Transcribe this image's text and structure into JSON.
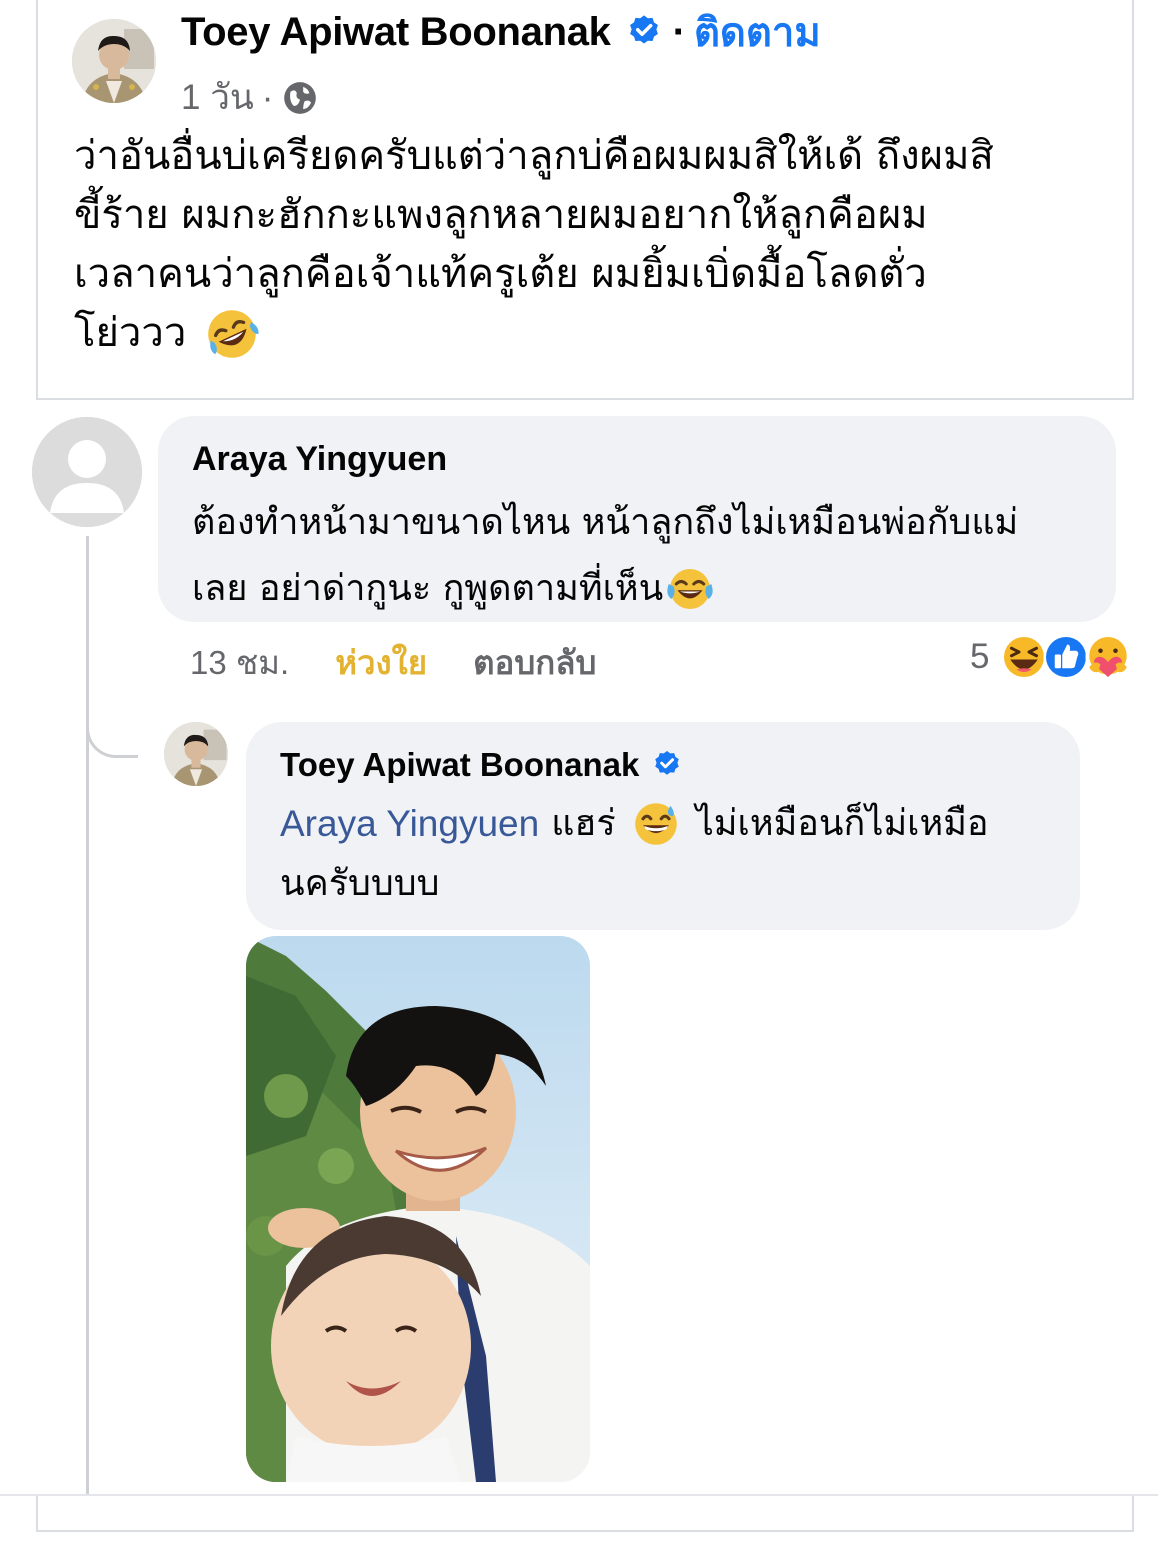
{
  "post": {
    "author": "Toey Apiwat Boonanak",
    "separator": "·",
    "follow_label": "ติดตาม",
    "time": "1 วัน",
    "meta_separator": "·",
    "privacy_icon": "globe-icon",
    "text_lines": [
      "ว่าอันอื่นบ่เครียดครับแต่ว่าลูกบ่คือผมผมสิให้เด้ ถึงผมสิ",
      "ขี้ร้าย ผมกะฮักกะแพงลูกหลายผมอยากให้ลูกคือผม",
      "เวลาคนว่าลูกคือเจ้าแท้ครูเต้ย ผมยิ้มเบิ่ดมื้อโลดตั่ว",
      "โย่ววว"
    ],
    "trailing_emoji": "rolling-on-floor-laughing-emoji"
  },
  "comment": {
    "author": "Araya Yingyuen",
    "text_lines": [
      "ต้องทำหน้ามาขนาดไหน หน้าลูกถึงไม่เหมือนพ่อกับแม่",
      "เลย อย่าด่ากูนะ กูพูดตามที่เห็น"
    ],
    "trailing_emoji": "tears-of-joy-emoji",
    "time": "13 ชม.",
    "reaction_label": "ห่วงใย",
    "reply_label": "ตอบกลับ",
    "reaction_count": "5",
    "reaction_icons": [
      "haha-icon",
      "like-icon",
      "care-icon"
    ]
  },
  "reply": {
    "author": "Toey Apiwat Boonanak",
    "mention": "Araya Yingyuen",
    "text_part1": "แฮร่",
    "emoji": "grinning-sweat-emoji",
    "text_part2": "ไม่เหมือนก็ไม่เหมือ",
    "text_line2": "นครับบบบ",
    "attachment": "photo-attachment"
  },
  "colors": {
    "link_blue": "#1877f2",
    "mention_blue": "#385898",
    "care_yellow": "#e2b230",
    "bubble_gray": "#f0f2f5",
    "meta_gray": "#65676b"
  }
}
